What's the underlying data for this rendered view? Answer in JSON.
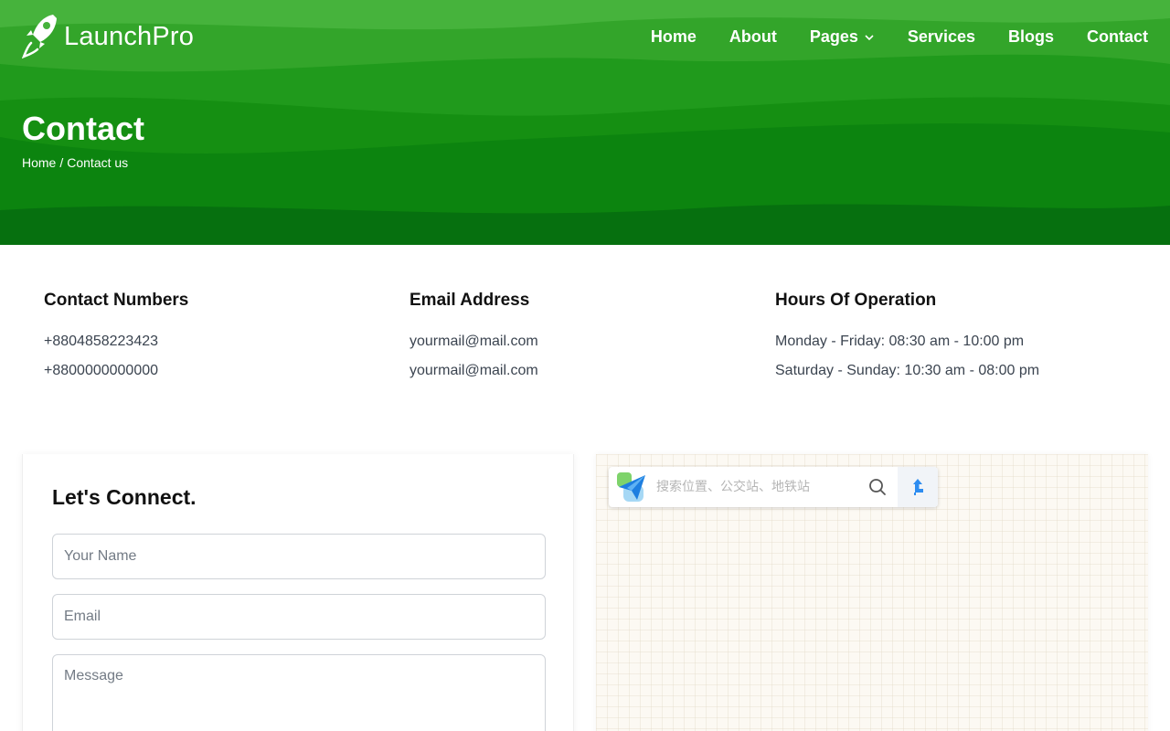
{
  "brand": {
    "name": "LaunchPro"
  },
  "nav": {
    "items": [
      {
        "label": "Home"
      },
      {
        "label": "About"
      },
      {
        "label": "Pages"
      },
      {
        "label": "Services"
      },
      {
        "label": "Blogs"
      },
      {
        "label": "Contact"
      }
    ]
  },
  "header": {
    "title": "Contact",
    "breadcrumb": {
      "home": "Home",
      "separator": "/",
      "current": "Contact us"
    }
  },
  "info": {
    "numbers": {
      "title": "Contact Numbers",
      "lines": [
        "+8804858223423",
        "+8800000000000"
      ]
    },
    "email": {
      "title": "Email Address",
      "lines": [
        "yourmail@mail.com",
        "yourmail@mail.com"
      ]
    },
    "hours": {
      "title": "Hours Of Operation",
      "lines": [
        "Monday - Friday: 08:30 am - 10:00 pm",
        "Saturday - Sunday: 10:30 am - 08:00 pm"
      ]
    }
  },
  "form": {
    "title": "Let's Connect.",
    "name_placeholder": "Your Name",
    "email_placeholder": "Email",
    "message_placeholder": "Message"
  },
  "map": {
    "search_placeholder": "搜索位置、公交站、地铁站"
  },
  "colors": {
    "hero_light": "#46b33c",
    "hero_dark": "#06700f",
    "route_blue": "#2d8cf0"
  },
  "icons": {
    "logo": "rocket-icon",
    "pages_dropdown": "chevron-down-icon",
    "map_logo": "paper-plane-icon",
    "map_search": "search-icon",
    "map_route": "route-arrow-icon"
  }
}
